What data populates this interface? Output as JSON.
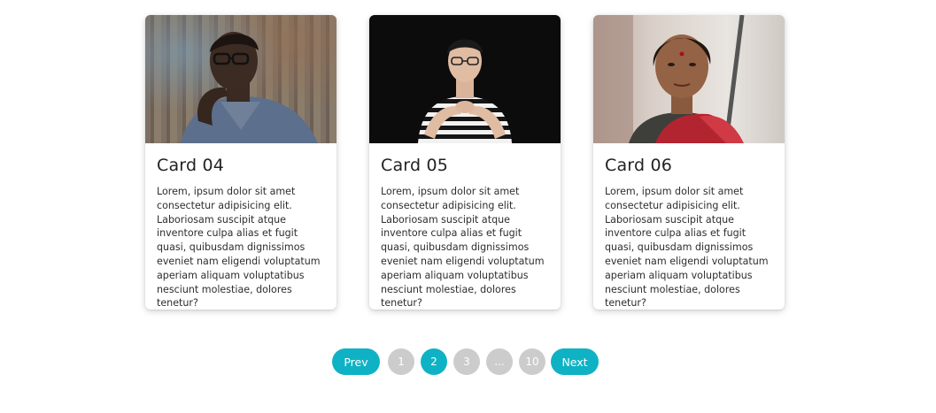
{
  "cards": [
    {
      "title": "Card 04",
      "text": "Lorem, ipsum dolor sit amet consectetur adipisicing elit. Laboriosam suscipit atque inventore culpa alias et fugit quasi, quibusdam dignissimos eveniet nam eligendi voluptatum aperiam aliquam voluptatibus nesciunt molestiae, dolores tenetur?"
    },
    {
      "title": "Card 05",
      "text": "Lorem, ipsum dolor sit amet consectetur adipisicing elit. Laboriosam suscipit atque inventore culpa alias et fugit quasi, quibusdam dignissimos eveniet nam eligendi voluptatum aperiam aliquam voluptatibus nesciunt molestiae, dolores tenetur?"
    },
    {
      "title": "Card 06",
      "text": "Lorem, ipsum dolor sit amet consectetur adipisicing elit. Laboriosam suscipit atque inventore culpa alias et fugit quasi, quibusdam dignissimos eveniet nam eligendi voluptatum aperiam aliquam voluptatibus nesciunt molestiae, dolores tenetur?"
    }
  ],
  "pagination": {
    "prev_label": "Prev",
    "next_label": "Next",
    "pages": [
      "1",
      "2",
      "3",
      "...",
      "10"
    ],
    "current": "2"
  },
  "colors": {
    "accent": "#0fb2c4",
    "inactive": "#cccccc"
  }
}
